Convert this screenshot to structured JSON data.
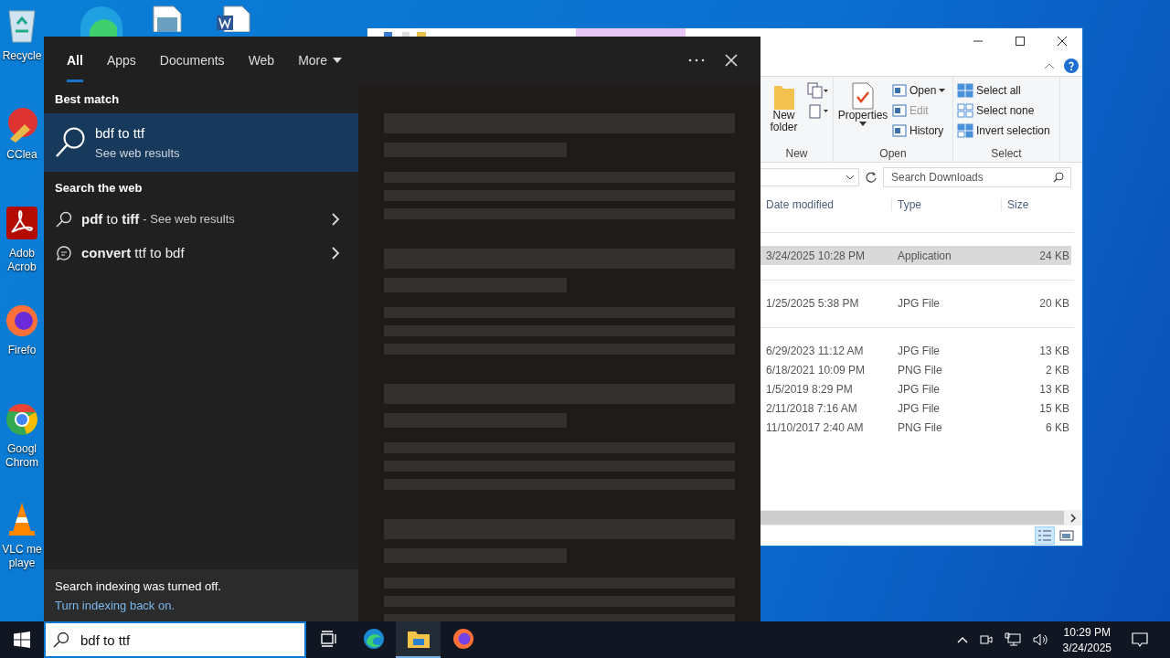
{
  "desktop": {
    "side_icons": [
      {
        "kind": "recycle",
        "lines": [
          "Recycle"
        ]
      },
      {
        "kind": "ccleaner",
        "lines": [
          "CClea"
        ]
      },
      {
        "kind": "acrobat",
        "lines": [
          "Adob",
          "Acrob"
        ]
      },
      {
        "kind": "firefox",
        "lines": [
          "Firefo"
        ]
      },
      {
        "kind": "chrome",
        "lines": [
          "Googl",
          "Chrom"
        ]
      },
      {
        "kind": "vlc",
        "lines": [
          "VLC me",
          "playe"
        ]
      }
    ],
    "top_icons": [
      {
        "kind": "edge"
      },
      {
        "kind": "image"
      },
      {
        "kind": "word"
      }
    ]
  },
  "explorer": {
    "ribbon_groups": [
      {
        "kind": "new",
        "label": "New",
        "buttons": [
          {
            "label": "New folder",
            "disabled": false
          }
        ]
      },
      {
        "kind": "open",
        "label": "Open",
        "buttons": [
          {
            "label": "Properties",
            "disabled": false
          },
          {
            "label": "Open",
            "disabled": false
          },
          {
            "label": "Edit",
            "disabled": true
          },
          {
            "label": "History",
            "disabled": false
          }
        ]
      },
      {
        "kind": "select",
        "label": "Select",
        "buttons": [
          {
            "label": "Select all",
            "disabled": false
          },
          {
            "label": "Select none",
            "disabled": false
          },
          {
            "label": "Invert selection",
            "disabled": false
          }
        ]
      }
    ],
    "search": {
      "placeholder": "Search Downloads"
    },
    "columns": [
      "Date modified",
      "Type",
      "Size"
    ],
    "groups": [
      {
        "rows": [
          {
            "date": "3/24/2025 10:28 PM",
            "type": "Application",
            "size": "24 KB",
            "selected": true
          }
        ]
      },
      {
        "rows": [
          {
            "date": "1/25/2025 5:38 PM",
            "type": "JPG File",
            "size": "20 KB",
            "selected": false
          }
        ]
      },
      {
        "rows": [
          {
            "date": "6/29/2023 11:12 AM",
            "type": "JPG File",
            "size": "13 KB",
            "selected": false
          },
          {
            "date": "6/18/2021 10:09 PM",
            "type": "PNG File",
            "size": "2 KB",
            "selected": false
          },
          {
            "date": "1/5/2019 8:29 PM",
            "type": "JPG File",
            "size": "13 KB",
            "selected": false
          },
          {
            "date": "2/11/2018 7:16 AM",
            "type": "JPG File",
            "size": "15 KB",
            "selected": false
          },
          {
            "date": "11/10/2017 2:40 AM",
            "type": "PNG File",
            "size": "6 KB",
            "selected": false
          }
        ]
      }
    ],
    "view": {
      "details_selected": true
    }
  },
  "search_panel": {
    "tabs": [
      {
        "label": "All",
        "selected": true,
        "dropdown": false
      },
      {
        "label": "Apps",
        "selected": false,
        "dropdown": false
      },
      {
        "label": "Documents",
        "selected": false,
        "dropdown": false
      },
      {
        "label": "Web",
        "selected": false,
        "dropdown": false
      },
      {
        "label": "More",
        "selected": false,
        "dropdown": true
      }
    ],
    "best_match_heading": "Best match",
    "best_match": {
      "title": "bdf to ttf",
      "subtitle": "See web results",
      "selected": true
    },
    "web_heading": "Search the web",
    "web_results": [
      {
        "kind": "search",
        "text": "**pdf** to **tiff**",
        "suffix": "- See web results"
      },
      {
        "kind": "chat",
        "text": "**convert** ttf to bdf"
      }
    ],
    "notice": "Search indexing was turned off.",
    "notice_link": "Turn indexing back on."
  },
  "taskbar": {
    "search_value": "bdf to ttf",
    "apps": [
      {
        "kind": "taskview",
        "running": false
      },
      {
        "kind": "edge",
        "running": false
      },
      {
        "kind": "explorer",
        "running": true
      },
      {
        "kind": "firefox",
        "running": false
      }
    ],
    "time": "10:29 PM",
    "date": "3/24/2025"
  }
}
